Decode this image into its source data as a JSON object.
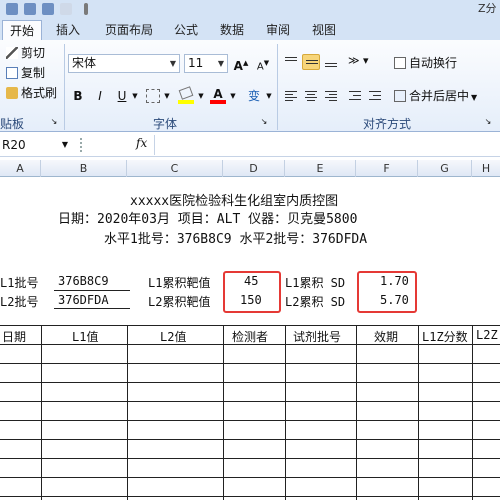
{
  "window": {
    "title_fragment": "Z分"
  },
  "tabs": [
    "开始",
    "插入",
    "页面布局",
    "公式",
    "数据",
    "审阅",
    "视图"
  ],
  "clipboard": {
    "cut": "剪切",
    "copy": "复制",
    "format_painter": "格式刷",
    "group": "贴板"
  },
  "font": {
    "name": "宋体",
    "size": "11",
    "bold": "B",
    "italic": "I",
    "underline": "U",
    "group": "字体",
    "grow": "A",
    "shrink": "A",
    "phonetic": "变"
  },
  "alignment": {
    "wrap": "自动换行",
    "merge": "合并后居中",
    "group": "对齐方式"
  },
  "formula_bar": {
    "name_box": "R20",
    "fx": "fx",
    "value": ""
  },
  "columns": [
    "A",
    "B",
    "C",
    "D",
    "E",
    "F",
    "G",
    "H"
  ],
  "sheet": {
    "title": "xxxxx医院检验科生化组室内质控图",
    "line2": "日期：2020年03月    项目：ALT    仪器：贝克曼5800",
    "line3": "水平1批号：376B8C9    水平2批号：376DFDA",
    "l1_lot_label": "L1批号",
    "l1_lot": "376B8C9",
    "l2_lot_label": "L2批号",
    "l2_lot": "376DFDA",
    "l1_mean_label": "L1累积靶值",
    "l1_mean": "45",
    "l2_mean_label": "L2累积靶值",
    "l2_mean": "150",
    "l1_sd_label": "L1累积 SD",
    "l1_sd": "1.70",
    "l2_sd_label": "L2累积 SD",
    "l2_sd": "5.70",
    "headers": [
      "日期",
      "L1值",
      "L2值",
      "检测者",
      "试剂批号",
      "效期",
      "L1Z分数",
      "L2Z"
    ]
  }
}
